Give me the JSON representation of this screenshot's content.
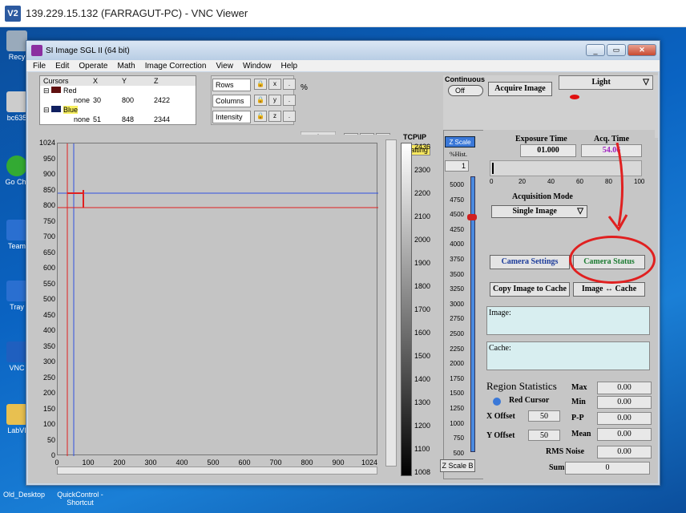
{
  "vnc": {
    "title": "139.229.15.132 (FARRAGUT-PC) - VNC Viewer",
    "logo": "V2"
  },
  "desktop": {
    "icons": [
      "Recy",
      "bc635",
      "Go Chr",
      "Team",
      "Tray",
      "VNC",
      "LabVI"
    ],
    "bottom": [
      "Old_Desktop",
      "QuickControl - Shortcut"
    ]
  },
  "app": {
    "title": "SI Image SGL II  (64 bit)",
    "menu": [
      "File",
      "Edit",
      "Operate",
      "Math",
      "Image Correction",
      "View",
      "Window",
      "Help"
    ],
    "cursors": {
      "headers": [
        "Cursors",
        "X",
        "Y",
        "Z"
      ],
      "rows": [
        {
          "name": "Red",
          "mode": "none",
          "x": "30",
          "y": "800",
          "z": "2422",
          "color": "#e02020"
        },
        {
          "name": "Blue",
          "mode": "none",
          "x": "51",
          "y": "848",
          "z": "2344",
          "color": "#2040e0"
        }
      ]
    },
    "rci": [
      "Rows",
      "Columns",
      "Intensity"
    ],
    "percent_sign": "%",
    "tcpip": "TCP\\IP",
    "waiting": "Waiting",
    "l_button": "L",
    "continuous": "Continuous",
    "off": "Off",
    "acquire": "Acquire Image",
    "light": "Light",
    "zscale": "Z Scale",
    "zscale_b": "Z Scale B",
    "hist_label": "%Hist.",
    "hist_value": "1",
    "exposure_label": "Exposure Time",
    "exposure_value": "01.000",
    "acq_label": "Acq. Time",
    "acq_value": "54.06",
    "progress_ticks": [
      "0",
      "20",
      "40",
      "60",
      "80",
      "100"
    ],
    "acq_mode_label": "Acquisition Mode",
    "acq_mode_value": "Single Image",
    "camera_settings": "Camera Settings",
    "camera_status": "Camera Status",
    "copy_cache": "Copy Image to Cache",
    "image_cache": "Image ↔ Cache",
    "image_label": "Image:",
    "cache_label": "Cache:",
    "region_stats": "Region Statistics",
    "red_cursor": "Red Cursor",
    "x_offset_label": "X Offset",
    "x_offset": "50",
    "y_offset_label": "Y Offset",
    "y_offset": "50",
    "stats": [
      {
        "label": "Max",
        "value": "0.00"
      },
      {
        "label": "Min",
        "value": "0.00"
      },
      {
        "label": "P-P",
        "value": "0.00"
      },
      {
        "label": "Mean",
        "value": "0.00"
      },
      {
        "label": "RMS Noise",
        "value": "0.00"
      },
      {
        "label": "Sum",
        "value": "0"
      }
    ],
    "plot": {
      "yticks": [
        "1024",
        "950",
        "900",
        "850",
        "800",
        "750",
        "700",
        "650",
        "600",
        "550",
        "500",
        "450",
        "400",
        "350",
        "300",
        "250",
        "200",
        "150",
        "100",
        "50",
        "0"
      ],
      "xticks": [
        "0",
        "100",
        "200",
        "300",
        "400",
        "500",
        "600",
        "700",
        "800",
        "900",
        "1024"
      ]
    },
    "colorbar_ticks": [
      "2436",
      "2300",
      "2200",
      "2100",
      "2000",
      "1900",
      "1800",
      "1700",
      "1600",
      "1500",
      "1400",
      "1300",
      "1200",
      "1100",
      "1008"
    ],
    "zscale_ticks": [
      "5000",
      "4750",
      "4500",
      "4250",
      "4000",
      "3750",
      "3500",
      "3250",
      "3000",
      "2750",
      "2500",
      "2250",
      "2000",
      "1750",
      "1500",
      "1250",
      "1000",
      "750",
      "500"
    ]
  }
}
